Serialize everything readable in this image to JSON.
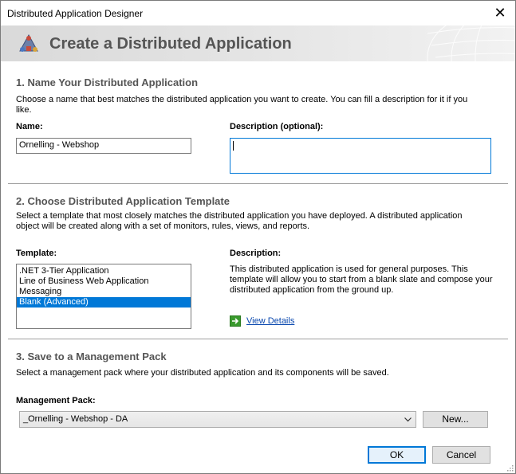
{
  "window": {
    "title": "Distributed Application Designer",
    "close_glyph": "✕"
  },
  "banner": {
    "title": "Create a Distributed Application",
    "icon": "distributed-app-icon"
  },
  "section1": {
    "title": "1. Name Your Distributed Application",
    "description": "Choose a name that best matches the distributed application you want to create. You can fill a description for it if you like.",
    "name_label": "Name:",
    "name_value": "Ornelling - Webshop",
    "description_label": "Description (optional):",
    "description_value": ""
  },
  "section2": {
    "title": "2. Choose Distributed Application Template",
    "description": "Select a template that most closely matches the distributed application you have deployed. A distributed application object will be created along with a set of monitors, rules, views, and reports.",
    "template_label": "Template:",
    "templates": [
      ".NET 3-Tier Application",
      "Line of Business Web Application",
      "Messaging",
      "Blank (Advanced)"
    ],
    "selected_index": 3,
    "template_description_label": "Description:",
    "template_description": "This distributed application is used for general purposes. This template will allow you to start from a blank slate and compose your distributed application from the ground up.",
    "view_details": "View Details"
  },
  "section3": {
    "title": "3. Save to a Management Pack",
    "description": "Select a management pack where your distributed application and its components will be saved.",
    "mp_label": "Management Pack:",
    "mp_value": "_Ornelling - Webshop - DA",
    "new_button": "New..."
  },
  "footer": {
    "ok": "OK",
    "cancel": "Cancel"
  },
  "colors": {
    "accent": "#0078d7",
    "heading": "#555555",
    "link": "#0645ad",
    "view_details_icon": "#3a9a2e"
  }
}
